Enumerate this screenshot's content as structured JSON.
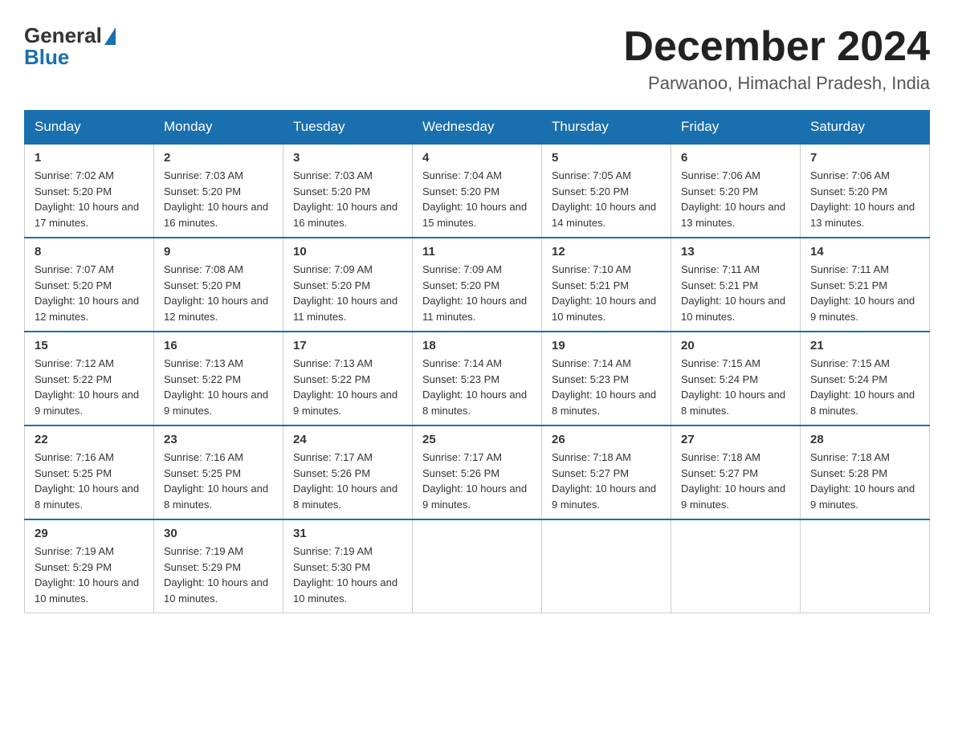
{
  "header": {
    "logo_general": "General",
    "logo_blue": "Blue",
    "month_title": "December 2024",
    "location": "Parwanoo, Himachal Pradesh, India"
  },
  "days_of_week": [
    "Sunday",
    "Monday",
    "Tuesday",
    "Wednesday",
    "Thursday",
    "Friday",
    "Saturday"
  ],
  "weeks": [
    [
      {
        "day": "1",
        "sunrise": "7:02 AM",
        "sunset": "5:20 PM",
        "daylight": "10 hours and 17 minutes."
      },
      {
        "day": "2",
        "sunrise": "7:03 AM",
        "sunset": "5:20 PM",
        "daylight": "10 hours and 16 minutes."
      },
      {
        "day": "3",
        "sunrise": "7:03 AM",
        "sunset": "5:20 PM",
        "daylight": "10 hours and 16 minutes."
      },
      {
        "day": "4",
        "sunrise": "7:04 AM",
        "sunset": "5:20 PM",
        "daylight": "10 hours and 15 minutes."
      },
      {
        "day": "5",
        "sunrise": "7:05 AM",
        "sunset": "5:20 PM",
        "daylight": "10 hours and 14 minutes."
      },
      {
        "day": "6",
        "sunrise": "7:06 AM",
        "sunset": "5:20 PM",
        "daylight": "10 hours and 13 minutes."
      },
      {
        "day": "7",
        "sunrise": "7:06 AM",
        "sunset": "5:20 PM",
        "daylight": "10 hours and 13 minutes."
      }
    ],
    [
      {
        "day": "8",
        "sunrise": "7:07 AM",
        "sunset": "5:20 PM",
        "daylight": "10 hours and 12 minutes."
      },
      {
        "day": "9",
        "sunrise": "7:08 AM",
        "sunset": "5:20 PM",
        "daylight": "10 hours and 12 minutes."
      },
      {
        "day": "10",
        "sunrise": "7:09 AM",
        "sunset": "5:20 PM",
        "daylight": "10 hours and 11 minutes."
      },
      {
        "day": "11",
        "sunrise": "7:09 AM",
        "sunset": "5:20 PM",
        "daylight": "10 hours and 11 minutes."
      },
      {
        "day": "12",
        "sunrise": "7:10 AM",
        "sunset": "5:21 PM",
        "daylight": "10 hours and 10 minutes."
      },
      {
        "day": "13",
        "sunrise": "7:11 AM",
        "sunset": "5:21 PM",
        "daylight": "10 hours and 10 minutes."
      },
      {
        "day": "14",
        "sunrise": "7:11 AM",
        "sunset": "5:21 PM",
        "daylight": "10 hours and 9 minutes."
      }
    ],
    [
      {
        "day": "15",
        "sunrise": "7:12 AM",
        "sunset": "5:22 PM",
        "daylight": "10 hours and 9 minutes."
      },
      {
        "day": "16",
        "sunrise": "7:13 AM",
        "sunset": "5:22 PM",
        "daylight": "10 hours and 9 minutes."
      },
      {
        "day": "17",
        "sunrise": "7:13 AM",
        "sunset": "5:22 PM",
        "daylight": "10 hours and 9 minutes."
      },
      {
        "day": "18",
        "sunrise": "7:14 AM",
        "sunset": "5:23 PM",
        "daylight": "10 hours and 8 minutes."
      },
      {
        "day": "19",
        "sunrise": "7:14 AM",
        "sunset": "5:23 PM",
        "daylight": "10 hours and 8 minutes."
      },
      {
        "day": "20",
        "sunrise": "7:15 AM",
        "sunset": "5:24 PM",
        "daylight": "10 hours and 8 minutes."
      },
      {
        "day": "21",
        "sunrise": "7:15 AM",
        "sunset": "5:24 PM",
        "daylight": "10 hours and 8 minutes."
      }
    ],
    [
      {
        "day": "22",
        "sunrise": "7:16 AM",
        "sunset": "5:25 PM",
        "daylight": "10 hours and 8 minutes."
      },
      {
        "day": "23",
        "sunrise": "7:16 AM",
        "sunset": "5:25 PM",
        "daylight": "10 hours and 8 minutes."
      },
      {
        "day": "24",
        "sunrise": "7:17 AM",
        "sunset": "5:26 PM",
        "daylight": "10 hours and 8 minutes."
      },
      {
        "day": "25",
        "sunrise": "7:17 AM",
        "sunset": "5:26 PM",
        "daylight": "10 hours and 9 minutes."
      },
      {
        "day": "26",
        "sunrise": "7:18 AM",
        "sunset": "5:27 PM",
        "daylight": "10 hours and 9 minutes."
      },
      {
        "day": "27",
        "sunrise": "7:18 AM",
        "sunset": "5:27 PM",
        "daylight": "10 hours and 9 minutes."
      },
      {
        "day": "28",
        "sunrise": "7:18 AM",
        "sunset": "5:28 PM",
        "daylight": "10 hours and 9 minutes."
      }
    ],
    [
      {
        "day": "29",
        "sunrise": "7:19 AM",
        "sunset": "5:29 PM",
        "daylight": "10 hours and 10 minutes."
      },
      {
        "day": "30",
        "sunrise": "7:19 AM",
        "sunset": "5:29 PM",
        "daylight": "10 hours and 10 minutes."
      },
      {
        "day": "31",
        "sunrise": "7:19 AM",
        "sunset": "5:30 PM",
        "daylight": "10 hours and 10 minutes."
      },
      null,
      null,
      null,
      null
    ]
  ]
}
